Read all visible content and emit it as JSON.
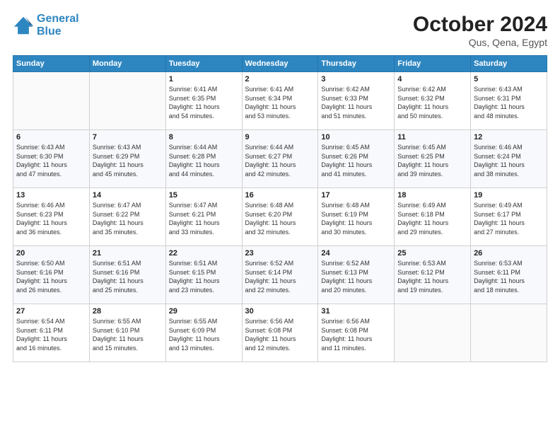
{
  "header": {
    "logo_line1": "General",
    "logo_line2": "Blue",
    "month": "October 2024",
    "location": "Qus, Qena, Egypt"
  },
  "weekdays": [
    "Sunday",
    "Monday",
    "Tuesday",
    "Wednesday",
    "Thursday",
    "Friday",
    "Saturday"
  ],
  "weeks": [
    [
      {
        "day": "",
        "info": ""
      },
      {
        "day": "",
        "info": ""
      },
      {
        "day": "1",
        "info": "Sunrise: 6:41 AM\nSunset: 6:35 PM\nDaylight: 11 hours\nand 54 minutes."
      },
      {
        "day": "2",
        "info": "Sunrise: 6:41 AM\nSunset: 6:34 PM\nDaylight: 11 hours\nand 53 minutes."
      },
      {
        "day": "3",
        "info": "Sunrise: 6:42 AM\nSunset: 6:33 PM\nDaylight: 11 hours\nand 51 minutes."
      },
      {
        "day": "4",
        "info": "Sunrise: 6:42 AM\nSunset: 6:32 PM\nDaylight: 11 hours\nand 50 minutes."
      },
      {
        "day": "5",
        "info": "Sunrise: 6:43 AM\nSunset: 6:31 PM\nDaylight: 11 hours\nand 48 minutes."
      }
    ],
    [
      {
        "day": "6",
        "info": "Sunrise: 6:43 AM\nSunset: 6:30 PM\nDaylight: 11 hours\nand 47 minutes."
      },
      {
        "day": "7",
        "info": "Sunrise: 6:43 AM\nSunset: 6:29 PM\nDaylight: 11 hours\nand 45 minutes."
      },
      {
        "day": "8",
        "info": "Sunrise: 6:44 AM\nSunset: 6:28 PM\nDaylight: 11 hours\nand 44 minutes."
      },
      {
        "day": "9",
        "info": "Sunrise: 6:44 AM\nSunset: 6:27 PM\nDaylight: 11 hours\nand 42 minutes."
      },
      {
        "day": "10",
        "info": "Sunrise: 6:45 AM\nSunset: 6:26 PM\nDaylight: 11 hours\nand 41 minutes."
      },
      {
        "day": "11",
        "info": "Sunrise: 6:45 AM\nSunset: 6:25 PM\nDaylight: 11 hours\nand 39 minutes."
      },
      {
        "day": "12",
        "info": "Sunrise: 6:46 AM\nSunset: 6:24 PM\nDaylight: 11 hours\nand 38 minutes."
      }
    ],
    [
      {
        "day": "13",
        "info": "Sunrise: 6:46 AM\nSunset: 6:23 PM\nDaylight: 11 hours\nand 36 minutes."
      },
      {
        "day": "14",
        "info": "Sunrise: 6:47 AM\nSunset: 6:22 PM\nDaylight: 11 hours\nand 35 minutes."
      },
      {
        "day": "15",
        "info": "Sunrise: 6:47 AM\nSunset: 6:21 PM\nDaylight: 11 hours\nand 33 minutes."
      },
      {
        "day": "16",
        "info": "Sunrise: 6:48 AM\nSunset: 6:20 PM\nDaylight: 11 hours\nand 32 minutes."
      },
      {
        "day": "17",
        "info": "Sunrise: 6:48 AM\nSunset: 6:19 PM\nDaylight: 11 hours\nand 30 minutes."
      },
      {
        "day": "18",
        "info": "Sunrise: 6:49 AM\nSunset: 6:18 PM\nDaylight: 11 hours\nand 29 minutes."
      },
      {
        "day": "19",
        "info": "Sunrise: 6:49 AM\nSunset: 6:17 PM\nDaylight: 11 hours\nand 27 minutes."
      }
    ],
    [
      {
        "day": "20",
        "info": "Sunrise: 6:50 AM\nSunset: 6:16 PM\nDaylight: 11 hours\nand 26 minutes."
      },
      {
        "day": "21",
        "info": "Sunrise: 6:51 AM\nSunset: 6:16 PM\nDaylight: 11 hours\nand 25 minutes."
      },
      {
        "day": "22",
        "info": "Sunrise: 6:51 AM\nSunset: 6:15 PM\nDaylight: 11 hours\nand 23 minutes."
      },
      {
        "day": "23",
        "info": "Sunrise: 6:52 AM\nSunset: 6:14 PM\nDaylight: 11 hours\nand 22 minutes."
      },
      {
        "day": "24",
        "info": "Sunrise: 6:52 AM\nSunset: 6:13 PM\nDaylight: 11 hours\nand 20 minutes."
      },
      {
        "day": "25",
        "info": "Sunrise: 6:53 AM\nSunset: 6:12 PM\nDaylight: 11 hours\nand 19 minutes."
      },
      {
        "day": "26",
        "info": "Sunrise: 6:53 AM\nSunset: 6:11 PM\nDaylight: 11 hours\nand 18 minutes."
      }
    ],
    [
      {
        "day": "27",
        "info": "Sunrise: 6:54 AM\nSunset: 6:11 PM\nDaylight: 11 hours\nand 16 minutes."
      },
      {
        "day": "28",
        "info": "Sunrise: 6:55 AM\nSunset: 6:10 PM\nDaylight: 11 hours\nand 15 minutes."
      },
      {
        "day": "29",
        "info": "Sunrise: 6:55 AM\nSunset: 6:09 PM\nDaylight: 11 hours\nand 13 minutes."
      },
      {
        "day": "30",
        "info": "Sunrise: 6:56 AM\nSunset: 6:08 PM\nDaylight: 11 hours\nand 12 minutes."
      },
      {
        "day": "31",
        "info": "Sunrise: 6:56 AM\nSunset: 6:08 PM\nDaylight: 11 hours\nand 11 minutes."
      },
      {
        "day": "",
        "info": ""
      },
      {
        "day": "",
        "info": ""
      }
    ]
  ]
}
